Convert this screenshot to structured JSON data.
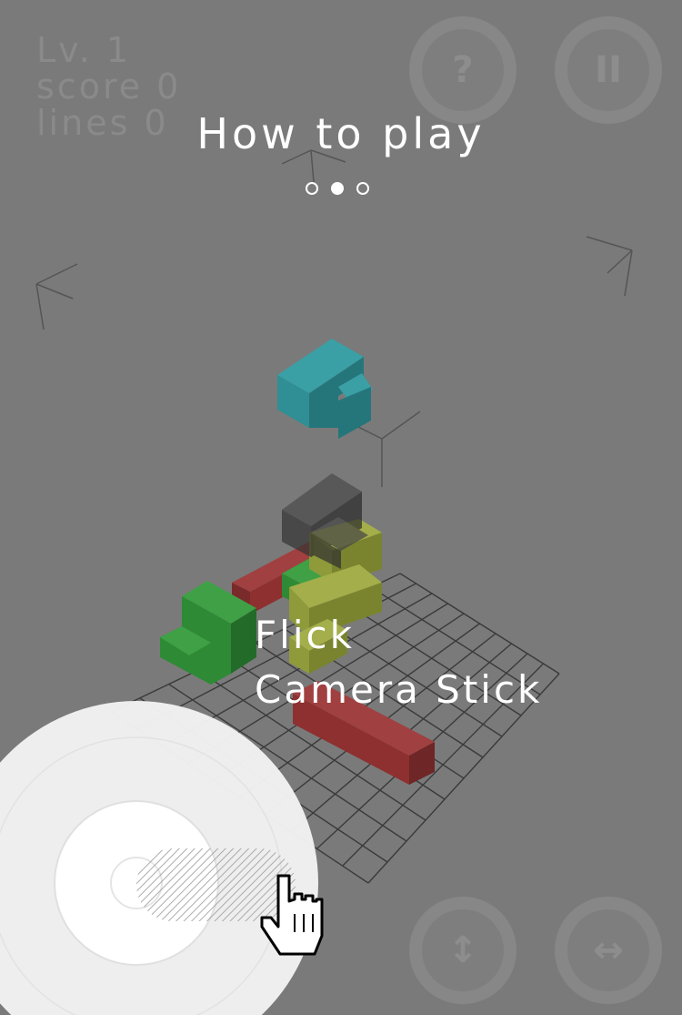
{
  "hud": {
    "level": "Lv. 1",
    "score": "score 0",
    "lines": "lines 0"
  },
  "buttons": {
    "help": "?",
    "pause": "II",
    "rotate_vertical": "↕",
    "rotate_horizontal": "↔"
  },
  "tutorial": {
    "title": "How to play",
    "page_count": 3,
    "current_page": 2,
    "caption_line1": "Flick",
    "caption_line2": "Camera Stick"
  },
  "colors": {
    "background": "#7a7a7a",
    "piece_cyan": "#2f8f95",
    "piece_green": "#2e8a35",
    "piece_olive": "#8f9a3a",
    "piece_red": "#8e3030",
    "ghost": "#3a3a3a"
  }
}
